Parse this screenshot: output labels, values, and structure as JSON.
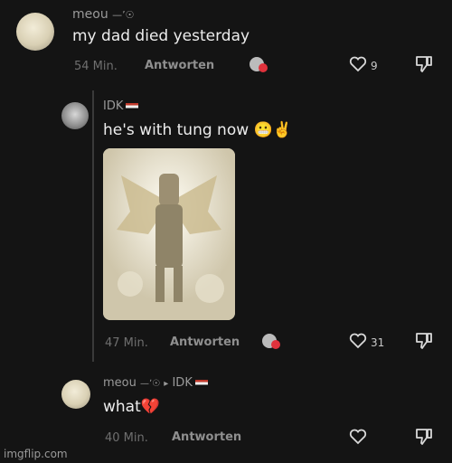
{
  "comments": [
    {
      "username": "meou",
      "username_suffix": "—ʼ☉",
      "text": "my dad died yesterday",
      "time": "54 Min.",
      "reply_label": "Antworten",
      "likes": "9"
    },
    {
      "username": "IDK",
      "text": "he's with tung now",
      "emoji": "😬✌️",
      "time": "47 Min.",
      "reply_label": "Antworten",
      "likes": "31"
    },
    {
      "username": "meou",
      "username_suffix": "—ʼ☉",
      "reply_to_arrow": "▸",
      "reply_to": "IDK",
      "text": "what",
      "emoji": "💔",
      "time": "40 Min.",
      "reply_label": "Antworten",
      "likes": ""
    }
  ],
  "watermark": "imgflip.com"
}
